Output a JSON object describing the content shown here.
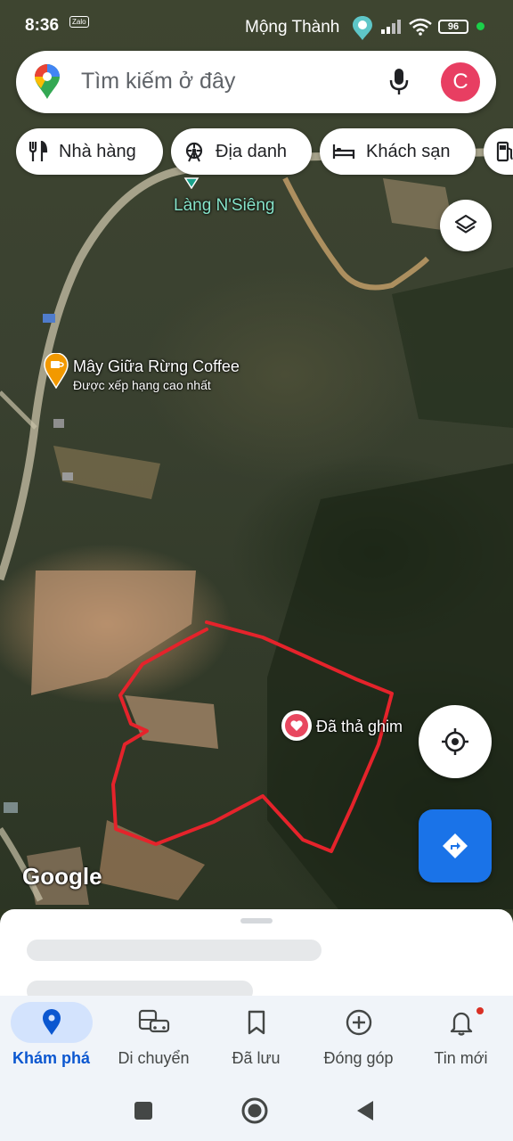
{
  "status_bar": {
    "time": "8:36",
    "app_badge": "Zalo",
    "carrier": "Mộng Thành",
    "battery": "96"
  },
  "search": {
    "placeholder": "Tìm kiếm ở đây",
    "avatar_letter": "C"
  },
  "chips": [
    {
      "label": "Nhà hàng",
      "icon": "restaurant-icon"
    },
    {
      "label": "Địa danh",
      "icon": "landmark-icon"
    },
    {
      "label": "Khách sạn",
      "icon": "hotel-icon"
    },
    {
      "label": "",
      "icon": "gas-station-icon"
    }
  ],
  "map": {
    "village_label": "Làng N'Siêng",
    "cafe_name": "Mây Giữa Rừng Coffee",
    "cafe_subtitle": "Được xếp hạng cao nhất",
    "pin_label": "Đã thả ghim",
    "google_logo": "Google",
    "pin_color": "#e8475f",
    "annotation_color": "#e5232b"
  },
  "nav": {
    "items": [
      {
        "label": "Khám phá",
        "icon": "explore-pin-icon",
        "active": true
      },
      {
        "label": "Di chuyển",
        "icon": "commute-icon",
        "active": false
      },
      {
        "label": "Đã lưu",
        "icon": "bookmark-icon",
        "active": false
      },
      {
        "label": "Đóng góp",
        "icon": "add-circle-icon",
        "active": false
      },
      {
        "label": "Tin mới",
        "icon": "bell-icon",
        "active": false
      }
    ]
  },
  "colors": {
    "accent": "#1a73e8",
    "active_nav_bg": "#d3e3fd",
    "active_nav_text": "#0b57d0"
  }
}
